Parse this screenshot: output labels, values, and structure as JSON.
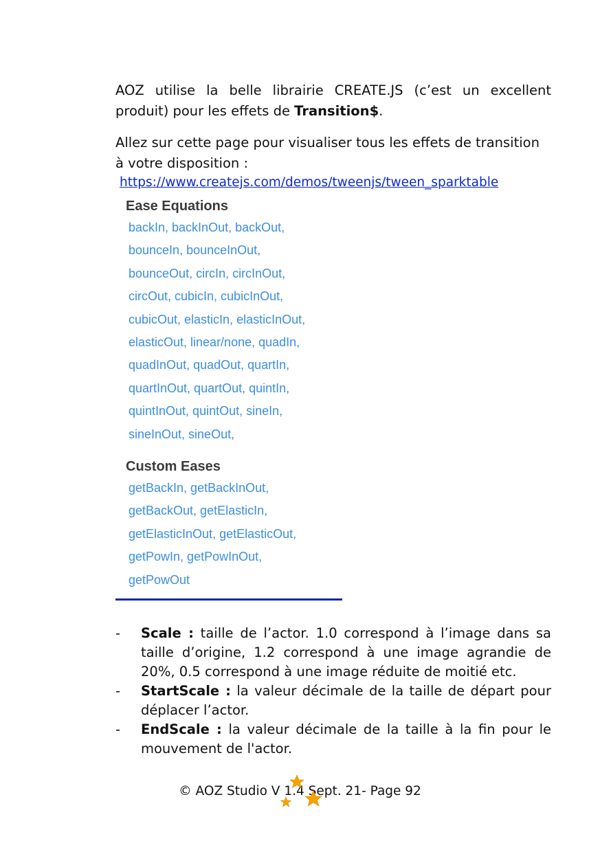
{
  "intro": {
    "text_before": "AOZ utilise la belle librairie CREATE.JS (c’est un excellent produit) pour les effets de ",
    "bold": "Transition$",
    "text_after": "."
  },
  "visit": {
    "text": "Allez sur cette page pour visualiser tous les effets de transition à votre disposition :",
    "link": "https://www.createjs.com/demos/tweenjs/tween_sparktable"
  },
  "ease_figure": {
    "ease_equations": {
      "heading": "Ease Equations",
      "lines": [
        "backIn,  backInOut,  backOut,",
        "bounceIn,  bounceInOut,",
        "bounceOut,  circIn,  circInOut,",
        "circOut,  cubicIn,  cubicInOut,",
        "cubicOut,  elasticIn,  elasticInOut,",
        "elasticOut,  linear/none,  quadIn,",
        "quadInOut,  quadOut,  quartIn,",
        "quartInOut,  quartOut,  quintIn,",
        "quintInOut,  quintOut,  sineIn,",
        "sineInOut,  sineOut,"
      ]
    },
    "custom_eases": {
      "heading": "Custom Eases",
      "lines": [
        "getBackIn,  getBackInOut,",
        "getBackOut,  getElasticIn,",
        "getElasticInOut,  getElasticOut,",
        "getPowIn,  getPowInOut,",
        "getPowOut"
      ]
    }
  },
  "bullets": [
    {
      "dash": "-",
      "term": "Scale :",
      "text": " taille de l’actor. 1.0 correspond à l’image dans sa taille d’origine, 1.2 correspond à une image agrandie de 20%, 0.5 correspond à une image réduite de moitié etc."
    },
    {
      "dash": "-",
      "term": "StartScale :",
      "text": " la valeur décimale de la taille de départ pour déplacer l’actor."
    },
    {
      "dash": "-",
      "term": "EndScale :",
      "text": " la valeur décimale de la taille à la fin pour le mouvement de l'actor."
    }
  ],
  "footer": "© AOZ Studio V 1.4  Sept. 21- Page 92",
  "colors": {
    "link": "#0b2bcf",
    "ease_item": "#3b8ee0",
    "heading": "#3a3a3a",
    "rule": "#1428a8",
    "star": "#f5a300"
  }
}
